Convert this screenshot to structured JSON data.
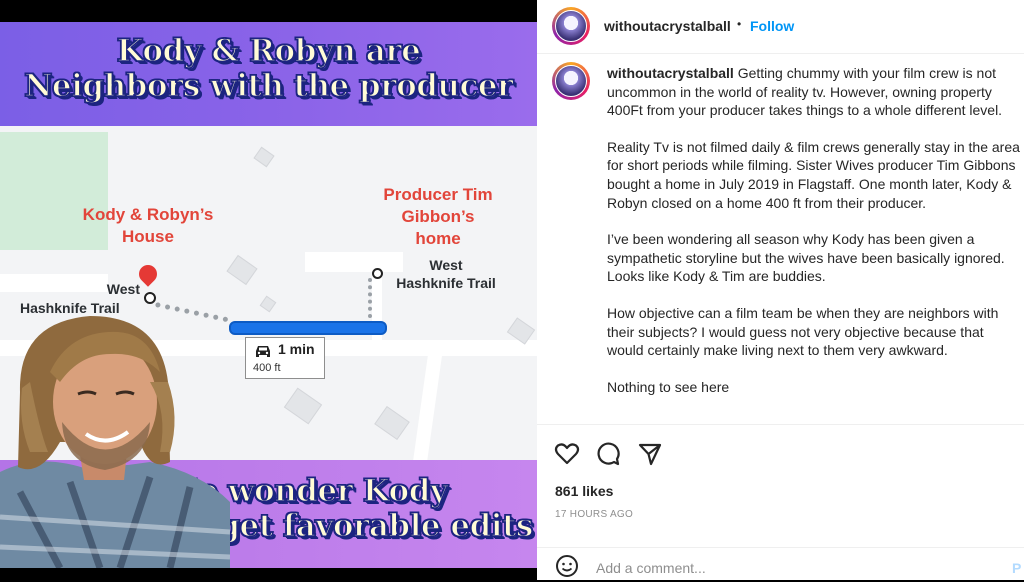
{
  "image": {
    "top_banner_line1": "Kody & Robyn are",
    "top_banner_line2": "Neighbors with the producer",
    "bottom_banner_line1": "No wonder Kody",
    "bottom_banner_line2": "& Robyn get favorable edits",
    "map": {
      "kody_house_label_1": "Kody & Robyn’s",
      "kody_house_label_2": "House",
      "producer_label_1": "Producer Tim",
      "producer_label_2": "Gibbon’s",
      "producer_label_3": "home",
      "left_street_1": "West",
      "left_street_2": "Hashknife Trail",
      "right_street_1": "West",
      "right_street_2": "Hashknife Trail",
      "drive_time": "1 min",
      "drive_distance": "400 ft"
    }
  },
  "header": {
    "username": "withoutacrystalball",
    "separator": "•",
    "follow_label": "Follow"
  },
  "caption": {
    "username": "withoutacrystalball",
    "para1": "Getting chummy with your film crew is not uncommon in the world of reality tv. However, owning property 400Ft from your producer takes things to a whole different level.",
    "para2": "Reality Tv is not filmed daily & film crews generally stay in the area for short periods while filming. Sister Wives producer Tim Gibbons bought a home in July 2019 in Flagstaff. One month later, Kody & Robyn closed on a home 400 ft from their producer.",
    "para3": "I’ve been wondering all season why Kody has been given a sympathetic storyline but the wives have been basically ignored. Looks like Kody & Tim are buddies.",
    "para4": "How objective can a film team be when they are neighbors with their subjects? I would guess not very objective because that would certainly make living next to them very awkward.",
    "para5": "Nothing to see here"
  },
  "actions": {
    "like_icon": "heart-icon",
    "comment_icon": "comment-icon",
    "share_icon": "share-icon",
    "likes": "861 likes",
    "time_ago": "17 HOURS AGO"
  },
  "comment": {
    "emoji_icon": "emoji-icon",
    "placeholder": "Add a comment...",
    "post_label": "P"
  },
  "colors": {
    "accent": "#0095f6",
    "route": "#1a73e8",
    "map_label_red": "#e2453a",
    "banner_top": "#8a63e8",
    "banner_bottom": "#c07eeb"
  }
}
